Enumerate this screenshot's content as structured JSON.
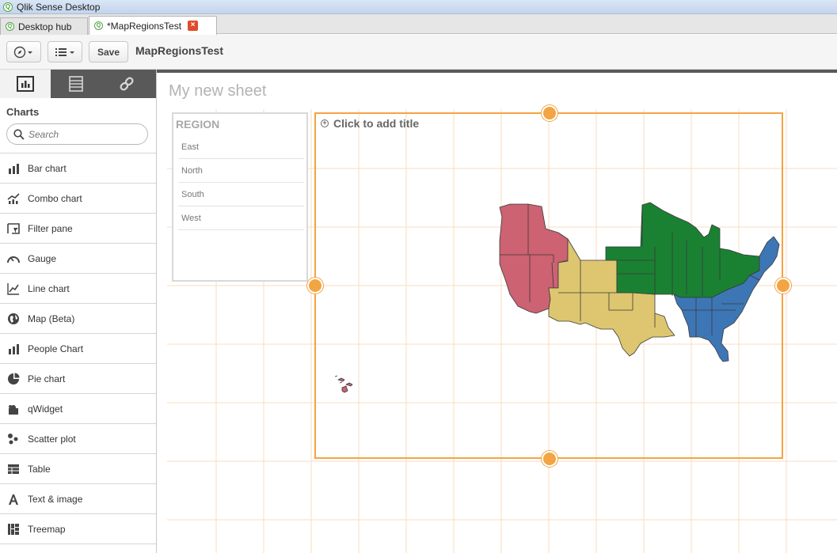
{
  "window": {
    "title": "Qlik Sense Desktop"
  },
  "tabs": [
    {
      "label": "Desktop hub"
    },
    {
      "label": "*MapRegionsTest"
    }
  ],
  "toolbar": {
    "save_label": "Save",
    "app_name": "MapRegionsTest"
  },
  "sidebar": {
    "tabs": [
      "charts-icon",
      "fields-icon",
      "link-icon"
    ],
    "section_title": "Charts",
    "search_placeholder": "Search",
    "items": [
      {
        "label": "Bar chart",
        "icon": "bar-chart-icon"
      },
      {
        "label": "Combo chart",
        "icon": "combo-chart-icon"
      },
      {
        "label": "Filter pane",
        "icon": "filter-pane-icon"
      },
      {
        "label": "Gauge",
        "icon": "gauge-icon"
      },
      {
        "label": "Line chart",
        "icon": "line-chart-icon"
      },
      {
        "label": "Map (Beta)",
        "icon": "map-icon"
      },
      {
        "label": "People Chart",
        "icon": "people-chart-icon"
      },
      {
        "label": "Pie chart",
        "icon": "pie-chart-icon"
      },
      {
        "label": "qWidget",
        "icon": "qwidget-icon"
      },
      {
        "label": "Scatter plot",
        "icon": "scatter-plot-icon"
      },
      {
        "label": "Table",
        "icon": "table-icon"
      },
      {
        "label": "Text & image",
        "icon": "text-image-icon"
      },
      {
        "label": "Treemap",
        "icon": "treemap-icon"
      }
    ]
  },
  "sheet": {
    "title": "My new sheet",
    "filter": {
      "header": "REGION",
      "values": [
        "East",
        "North",
        "South",
        "West"
      ]
    },
    "map": {
      "add_title": "Click to add title",
      "region_colors": {
        "West": "#cc6272",
        "South": "#ddc66f",
        "North": "#1a8133",
        "East": "#3d76b5"
      }
    }
  },
  "colors": {
    "accent": "#f3a443",
    "title_bar": "#c3d5ec"
  }
}
